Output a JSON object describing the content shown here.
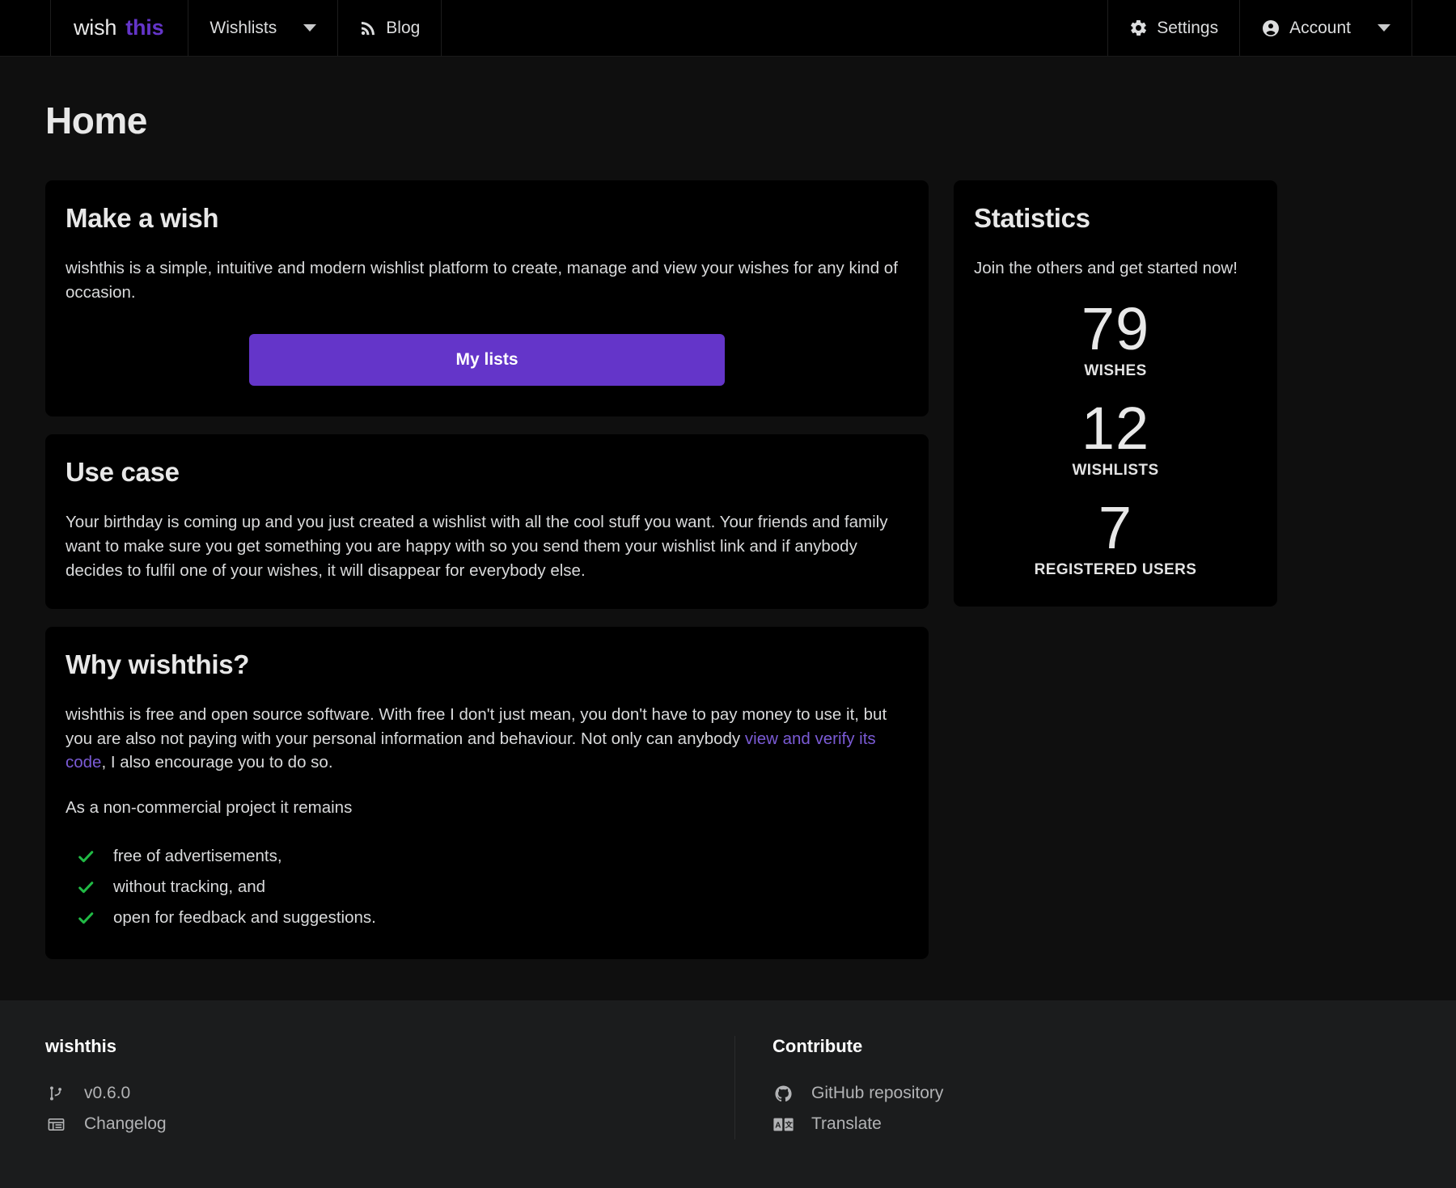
{
  "navbar": {
    "brand": {
      "first": "wish",
      "second": "this"
    },
    "items": [
      {
        "label": "Wishlists",
        "icon": "chevron-down-icon"
      },
      {
        "label": "Blog",
        "icon": "rss-icon"
      }
    ],
    "right_items": [
      {
        "label": "Settings",
        "icon": "gear-icon"
      },
      {
        "label": "Account",
        "icon": "user-circle-icon"
      }
    ]
  },
  "page": {
    "title": "Home"
  },
  "cards": {
    "make_a_wish": {
      "heading": "Make a wish",
      "body": "wishthis is a simple, intuitive and modern wishlist platform to create, manage and view your wishes for any kind of occasion.",
      "button": "My lists"
    },
    "use_case": {
      "heading": "Use case",
      "body": "Your birthday is coming up and you just created a wishlist with all the cool stuff you want. Your friends and family want to make sure you get something you are happy with so you send them your wishlist link and if anybody decides to fulfil one of your wishes, it will disappear for everybody else."
    },
    "why_wishthis": {
      "heading": "Why wishthis?",
      "body_part1": "wishthis is free and open source software. With free I don't just mean, you don't have to pay money to use it, but you are also not paying with your personal information and behaviour. Not only can anybody ",
      "link_text": "view and verify its code",
      "body_part2": ", I also encourage you to do so.",
      "body_second": "As a non-commercial project it remains",
      "list": [
        "free of advertisements,",
        "without tracking, and",
        "open for feedback and suggestions."
      ]
    }
  },
  "statistics": {
    "heading": "Statistics",
    "subtitle": "Join the others and get started now!",
    "items": [
      {
        "value": "79",
        "label": "WISHES"
      },
      {
        "value": "12",
        "label": "WISHLISTS"
      },
      {
        "value": "7",
        "label": "REGISTERED USERS"
      }
    ]
  },
  "footer": {
    "columns": [
      {
        "heading": "wishthis",
        "rows": [
          {
            "label": "v0.6.0",
            "icon": "code-branch-icon"
          },
          {
            "label": "Changelog",
            "icon": "list-table-icon"
          }
        ]
      },
      {
        "heading": "Contribute",
        "rows": [
          {
            "label": "GitHub repository",
            "icon": "github-icon"
          },
          {
            "label": "Translate",
            "icon": "translate-icon"
          }
        ]
      }
    ]
  },
  "colors": {
    "accent_purple": "#6435c9",
    "link_purple": "#7b5bd6",
    "check_green": "#21ba45",
    "card_background": "#000000",
    "page_background": "#0f0f0f",
    "footer_background": "#1b1c1d"
  }
}
